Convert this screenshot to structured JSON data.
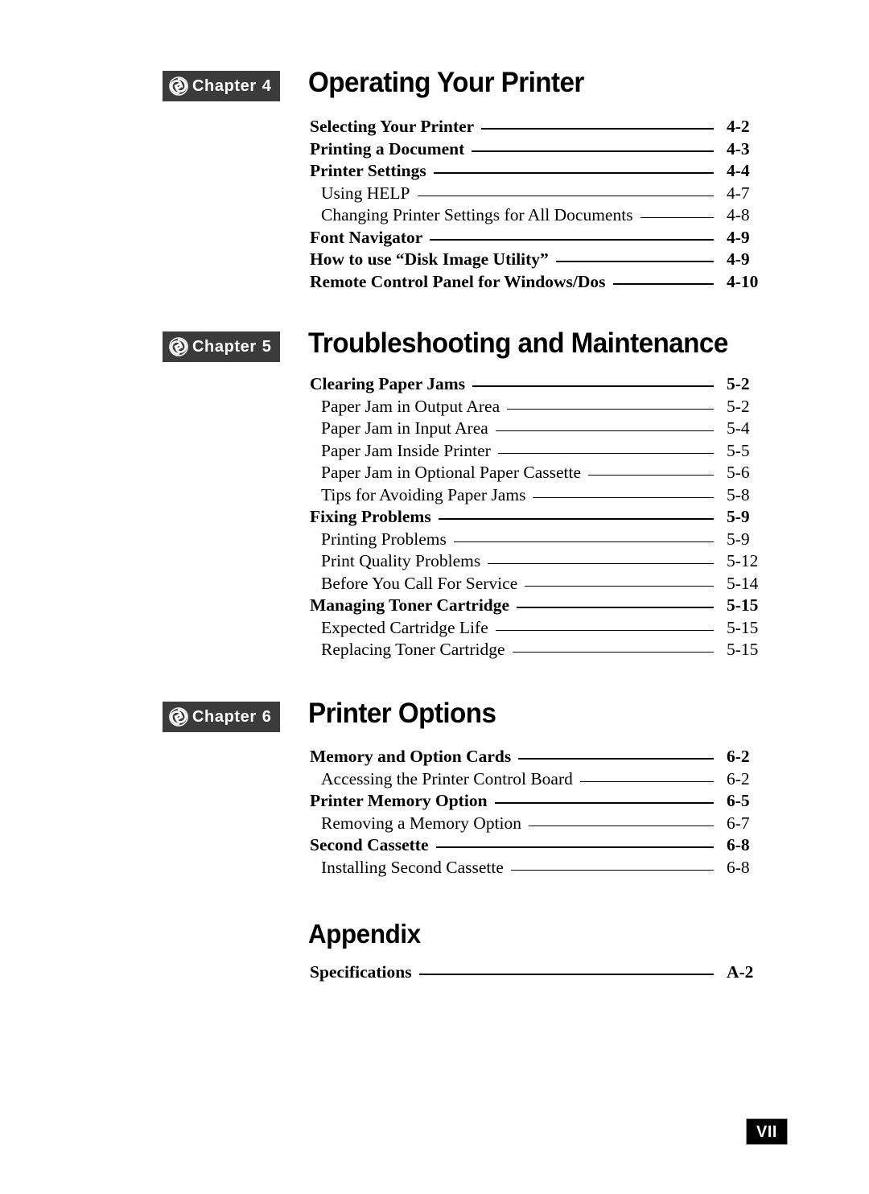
{
  "document": {
    "page_label": "VII",
    "badge_word": "Chapter",
    "badge_icon": "spiral-swirl-icon"
  },
  "sections": [
    {
      "badge_number": "4",
      "title": "Operating Your Printer",
      "has_badge": true,
      "entries": [
        {
          "label": "Selecting Your Printer",
          "page": "4-2",
          "level": 1
        },
        {
          "label": "Printing a Document",
          "page": "4-3",
          "level": 1
        },
        {
          "label": "Printer Settings",
          "page": "4-4",
          "level": 1
        },
        {
          "label": "Using HELP",
          "page": "4-7",
          "level": 2
        },
        {
          "label": "Changing Printer Settings for All Documents",
          "page": "4-8",
          "level": 2
        },
        {
          "label": "Font Navigator",
          "page": "4-9",
          "level": 1
        },
        {
          "label": "How to use “Disk Image Utility”",
          "page": "4-9",
          "level": 1
        },
        {
          "label": "Remote Control Panel for Windows/Dos",
          "page": "4-10",
          "level": 1
        }
      ]
    },
    {
      "badge_number": "5",
      "title": "Troubleshooting and Maintenance",
      "has_badge": true,
      "entries": [
        {
          "label": "Clearing Paper Jams",
          "page": "5-2",
          "level": 1
        },
        {
          "label": "Paper Jam in Output Area",
          "page": "5-2",
          "level": 2
        },
        {
          "label": "Paper Jam in Input Area",
          "page": "5-4",
          "level": 2
        },
        {
          "label": "Paper Jam Inside Printer",
          "page": "5-5",
          "level": 2
        },
        {
          "label": "Paper Jam in Optional Paper Cassette",
          "page": "5-6",
          "level": 2
        },
        {
          "label": "Tips for Avoiding Paper Jams",
          "page": "5-8",
          "level": 2
        },
        {
          "label": "Fixing Problems",
          "page": "5-9",
          "level": 1
        },
        {
          "label": "Printing Problems",
          "page": "5-9",
          "level": 2
        },
        {
          "label": "Print Quality Problems",
          "page": "5-12",
          "level": 2
        },
        {
          "label": "Before You Call For Service",
          "page": "5-14",
          "level": 2
        },
        {
          "label": "Managing Toner Cartridge",
          "page": "5-15",
          "level": 1
        },
        {
          "label": "Expected Cartridge Life",
          "page": "5-15",
          "level": 2
        },
        {
          "label": "Replacing Toner Cartridge",
          "page": "5-15",
          "level": 2
        }
      ]
    },
    {
      "badge_number": "6",
      "title": "Printer Options",
      "has_badge": true,
      "entries": [
        {
          "label": "Memory and Option Cards",
          "page": "6-2",
          "level": 1
        },
        {
          "label": "Accessing the Printer Control Board",
          "page": "6-2",
          "level": 2
        },
        {
          "label": "Printer Memory Option",
          "page": "6-5",
          "level": 1
        },
        {
          "label": "Removing a Memory Option",
          "page": "6-7",
          "level": 2
        },
        {
          "label": "Second Cassette",
          "page": "6-8",
          "level": 1
        },
        {
          "label": "Installing Second Cassette",
          "page": "6-8",
          "level": 2
        }
      ]
    },
    {
      "badge_number": "",
      "title": "Appendix",
      "has_badge": false,
      "entries": [
        {
          "label": "Specifications",
          "page": "A-2",
          "level": 1
        }
      ]
    }
  ],
  "layout": {
    "section_tops": [
      88,
      412,
      872,
      1140
    ],
    "toc_tops": [
      145,
      465,
      928,
      1196
    ]
  },
  "colors": {
    "badge_background": "#3b3b3b",
    "badge_text": "#ffffff",
    "page_number_background": "#000000",
    "page_number_text": "#ffffff",
    "text": "#000000",
    "paper": "#ffffff"
  }
}
